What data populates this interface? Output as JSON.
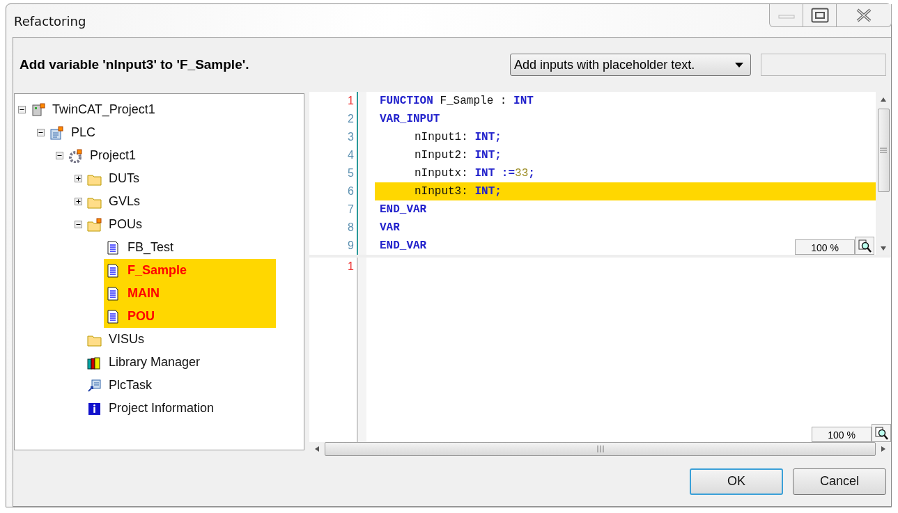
{
  "window": {
    "title": "Refactoring"
  },
  "message": "Add variable 'nInput3' to 'F_Sample'.",
  "mode_dropdown": {
    "value": "Add inputs with placeholder text."
  },
  "tree": [
    {
      "label": "TwinCAT_Project1",
      "kind": "project",
      "expanded": true,
      "highlighted": false,
      "children": [
        {
          "label": "PLC",
          "kind": "plc",
          "expanded": true,
          "highlighted": false,
          "children": [
            {
              "label": "Project1",
              "kind": "gear",
              "expanded": true,
              "highlighted": false,
              "children": [
                {
                  "label": "DUTs",
                  "kind": "folder",
                  "expanded": false,
                  "highlighted": false
                },
                {
                  "label": "GVLs",
                  "kind": "folder",
                  "expanded": false,
                  "highlighted": false
                },
                {
                  "label": "POUs",
                  "kind": "marked_folder",
                  "expanded": true,
                  "highlighted": false,
                  "children": [
                    {
                      "label": "FB_Test",
                      "kind": "file",
                      "highlighted": false
                    },
                    {
                      "label": "F_Sample",
                      "kind": "file",
                      "highlighted": true
                    },
                    {
                      "label": "MAIN",
                      "kind": "file",
                      "highlighted": true
                    },
                    {
                      "label": "POU",
                      "kind": "file",
                      "highlighted": true
                    }
                  ]
                },
                {
                  "label": "VISUs",
                  "kind": "folder",
                  "highlighted": false
                },
                {
                  "label": "Library Manager",
                  "kind": "library",
                  "highlighted": false
                },
                {
                  "label": "PlcTask",
                  "kind": "task",
                  "highlighted": false
                },
                {
                  "label": "Project Information",
                  "kind": "info",
                  "highlighted": false
                }
              ]
            }
          ]
        }
      ]
    }
  ],
  "declaration_editor": {
    "zoom": "100 %",
    "lines": [
      {
        "number": "1",
        "current": true,
        "highlighted": false,
        "indented": false,
        "tokens": [
          {
            "text": "FUNCTION",
            "kind": "keyword"
          },
          {
            "text": " F_Sample : ",
            "kind": "ident"
          },
          {
            "text": "INT",
            "kind": "keyword"
          }
        ]
      },
      {
        "number": "2",
        "current": false,
        "highlighted": false,
        "indented": false,
        "tokens": [
          {
            "text": "VAR_INPUT",
            "kind": "keyword"
          }
        ]
      },
      {
        "number": "3",
        "current": false,
        "highlighted": false,
        "indented": true,
        "tokens": [
          {
            "text": "nInput1: ",
            "kind": "ident"
          },
          {
            "text": "INT;",
            "kind": "keyword"
          }
        ]
      },
      {
        "number": "4",
        "current": false,
        "highlighted": false,
        "indented": true,
        "tokens": [
          {
            "text": "nInput2: ",
            "kind": "ident"
          },
          {
            "text": "INT;",
            "kind": "keyword"
          }
        ]
      },
      {
        "number": "5",
        "current": false,
        "highlighted": false,
        "indented": true,
        "tokens": [
          {
            "text": "nInputx: ",
            "kind": "ident"
          },
          {
            "text": "INT :=",
            "kind": "keyword"
          },
          {
            "text": "33",
            "kind": "number"
          },
          {
            "text": ";",
            "kind": "keyword"
          }
        ]
      },
      {
        "number": "6",
        "current": false,
        "highlighted": true,
        "indented": true,
        "tokens": [
          {
            "text": "nInput3: ",
            "kind": "ident"
          },
          {
            "text": "INT;",
            "kind": "keyword"
          }
        ]
      },
      {
        "number": "7",
        "current": false,
        "highlighted": false,
        "indented": false,
        "tokens": [
          {
            "text": "END_VAR",
            "kind": "keyword"
          }
        ]
      },
      {
        "number": "8",
        "current": false,
        "highlighted": false,
        "indented": false,
        "tokens": [
          {
            "text": "VAR",
            "kind": "keyword"
          }
        ]
      },
      {
        "number": "9",
        "current": false,
        "highlighted": false,
        "indented": false,
        "tokens": [
          {
            "text": "END_VAR",
            "kind": "keyword"
          }
        ]
      }
    ]
  },
  "body_editor": {
    "zoom": "100 %",
    "lines": [
      {
        "number": "1",
        "current": true
      }
    ]
  },
  "buttons": [
    {
      "label": "OK",
      "default": true
    },
    {
      "label": "Cancel",
      "default": false
    }
  ]
}
